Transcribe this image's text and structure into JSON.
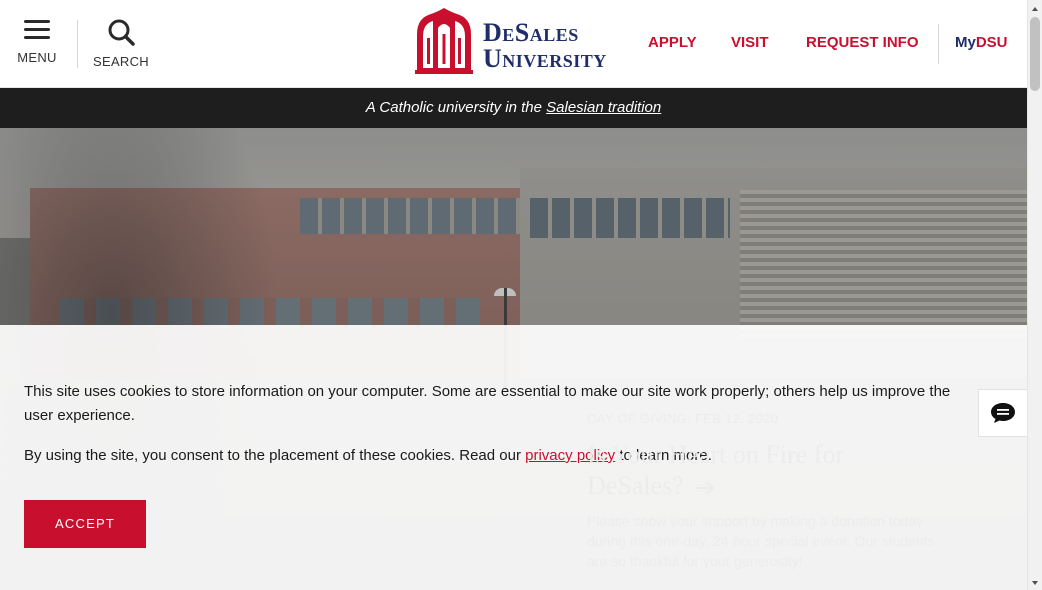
{
  "header": {
    "menu_label": "MENU",
    "search_label": "SEARCH",
    "logo_line1": "DeSales",
    "logo_line2": "University",
    "nav": {
      "apply": "APPLY",
      "visit": "VISIT",
      "request_info": "REQUEST INFO",
      "mydsu_my": "My",
      "mydsu_dsu": "DSU"
    }
  },
  "tagline": {
    "prefix": "A Catholic university in the ",
    "link": "Salesian tradition"
  },
  "feature": {
    "kicker": "DAY OF GIVING: FEB 12, 2020",
    "headline": "Is Your Heart on Fire for DeSales?",
    "blurb": "Please show your support by making a donation today during this one-day, 24-hour special event. Our students are so thankful for your generosity!"
  },
  "cookie_banner": {
    "line1": "This site uses cookies to store information on your computer. Some are essential to make our site work properly; others help us improve the",
    "line2": "user experience.",
    "line3_prefix": "By using the site, you consent to the placement of these cookies. Read our ",
    "line3_link": "privacy policy",
    "line3_suffix": " to learn more.",
    "accept_label": "ACCEPT"
  },
  "colors": {
    "brand_red": "#c8102e",
    "brand_navy": "#1f2d6b",
    "tagline_bg": "#1e1e1e"
  },
  "icons": [
    "menu-icon",
    "search-icon",
    "chat-icon",
    "arrow-right-icon"
  ]
}
